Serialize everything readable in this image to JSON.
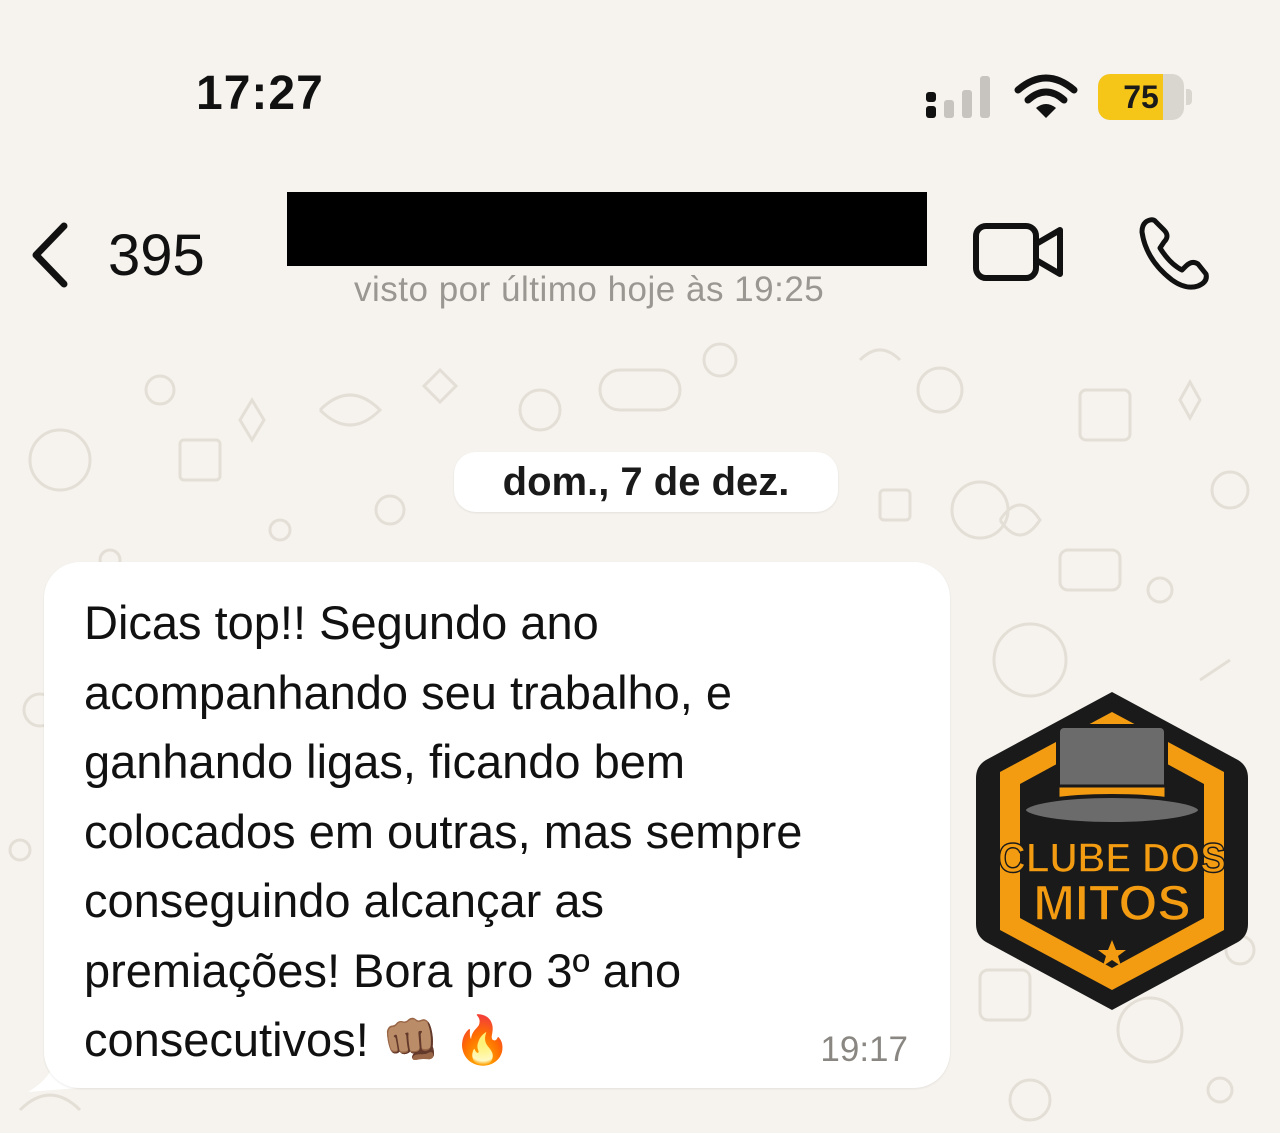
{
  "status_bar": {
    "time": "17:27",
    "battery_level": 75,
    "battery_label": "75",
    "icons": [
      "cellular-signal-icon",
      "wifi-icon",
      "battery-icon"
    ],
    "battery_color": "#f5c518"
  },
  "header": {
    "back_count": "395",
    "contact_name_redacted": true,
    "last_seen": "visto por último hoje às 19:25",
    "icons": [
      "back-chevron-icon",
      "video-call-icon",
      "phone-call-icon"
    ]
  },
  "chat": {
    "date_separator": "dom., 7 de dez.",
    "messages": [
      {
        "text": "Dicas top!! Segundo ano\nacompanhando seu trabalho, e\nganhando ligas, ficando bem\ncolocados em outras, mas sempre\nconseguindo alcançar as\npremiações! Bora pro 3º ano\nconsecutivos! 👊🏽 🔥",
        "time": "19:17",
        "direction": "incoming"
      }
    ]
  },
  "watermark_logo": {
    "line1": "CLUBE DOS",
    "line2": "MITOS",
    "color_primary": "#f39c12",
    "color_dark": "#1a1a1a"
  }
}
